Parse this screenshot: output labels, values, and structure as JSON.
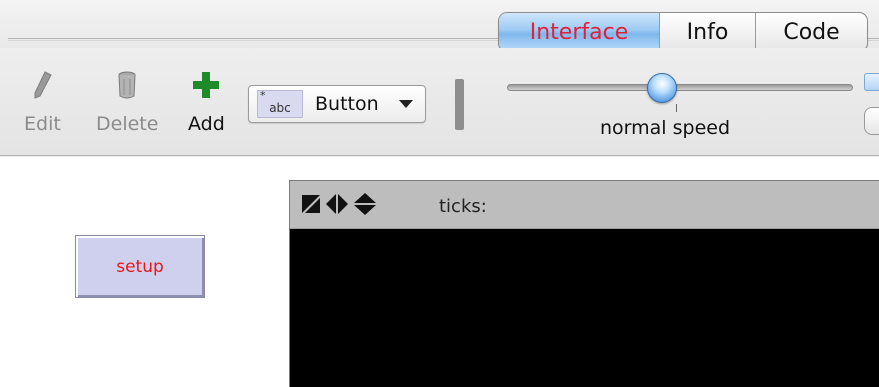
{
  "tabs": [
    {
      "label": "Interface",
      "active": true
    },
    {
      "label": "Info",
      "active": false
    },
    {
      "label": "Code",
      "active": false
    }
  ],
  "toolbar": {
    "edit_label": "Edit",
    "delete_label": "Delete",
    "add_label": "Add",
    "widget_select_value": "Button",
    "widget_badge_text": "abc",
    "speed_label": "normal speed",
    "speed_value": 0.5,
    "icons": {
      "edit": "pencil-icon",
      "delete": "trash-icon",
      "add": "plus-icon"
    }
  },
  "interface": {
    "setup_button_label": "setup",
    "view": {
      "ticks_label": "ticks:",
      "ticks_value": ""
    }
  },
  "colors": {
    "active_tab_text": "#e0213a",
    "add_icon": "#1f8a2a",
    "button_face": "#cfcfee",
    "button_text": "#e81818",
    "view_background": "#000000"
  }
}
